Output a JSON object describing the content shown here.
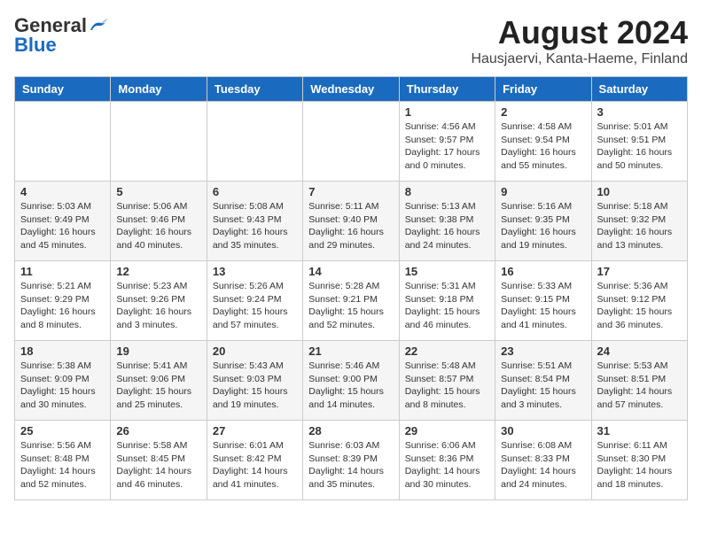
{
  "header": {
    "logo_general": "General",
    "logo_blue": "Blue",
    "month_year": "August 2024",
    "location": "Hausjaervi, Kanta-Haeme, Finland"
  },
  "days_of_week": [
    "Sunday",
    "Monday",
    "Tuesday",
    "Wednesday",
    "Thursday",
    "Friday",
    "Saturday"
  ],
  "weeks": [
    [
      {
        "day": "",
        "info": ""
      },
      {
        "day": "",
        "info": ""
      },
      {
        "day": "",
        "info": ""
      },
      {
        "day": "",
        "info": ""
      },
      {
        "day": "1",
        "info": "Sunrise: 4:56 AM\nSunset: 9:57 PM\nDaylight: 17 hours\nand 0 minutes."
      },
      {
        "day": "2",
        "info": "Sunrise: 4:58 AM\nSunset: 9:54 PM\nDaylight: 16 hours\nand 55 minutes."
      },
      {
        "day": "3",
        "info": "Sunrise: 5:01 AM\nSunset: 9:51 PM\nDaylight: 16 hours\nand 50 minutes."
      }
    ],
    [
      {
        "day": "4",
        "info": "Sunrise: 5:03 AM\nSunset: 9:49 PM\nDaylight: 16 hours\nand 45 minutes."
      },
      {
        "day": "5",
        "info": "Sunrise: 5:06 AM\nSunset: 9:46 PM\nDaylight: 16 hours\nand 40 minutes."
      },
      {
        "day": "6",
        "info": "Sunrise: 5:08 AM\nSunset: 9:43 PM\nDaylight: 16 hours\nand 35 minutes."
      },
      {
        "day": "7",
        "info": "Sunrise: 5:11 AM\nSunset: 9:40 PM\nDaylight: 16 hours\nand 29 minutes."
      },
      {
        "day": "8",
        "info": "Sunrise: 5:13 AM\nSunset: 9:38 PM\nDaylight: 16 hours\nand 24 minutes."
      },
      {
        "day": "9",
        "info": "Sunrise: 5:16 AM\nSunset: 9:35 PM\nDaylight: 16 hours\nand 19 minutes."
      },
      {
        "day": "10",
        "info": "Sunrise: 5:18 AM\nSunset: 9:32 PM\nDaylight: 16 hours\nand 13 minutes."
      }
    ],
    [
      {
        "day": "11",
        "info": "Sunrise: 5:21 AM\nSunset: 9:29 PM\nDaylight: 16 hours\nand 8 minutes."
      },
      {
        "day": "12",
        "info": "Sunrise: 5:23 AM\nSunset: 9:26 PM\nDaylight: 16 hours\nand 3 minutes."
      },
      {
        "day": "13",
        "info": "Sunrise: 5:26 AM\nSunset: 9:24 PM\nDaylight: 15 hours\nand 57 minutes."
      },
      {
        "day": "14",
        "info": "Sunrise: 5:28 AM\nSunset: 9:21 PM\nDaylight: 15 hours\nand 52 minutes."
      },
      {
        "day": "15",
        "info": "Sunrise: 5:31 AM\nSunset: 9:18 PM\nDaylight: 15 hours\nand 46 minutes."
      },
      {
        "day": "16",
        "info": "Sunrise: 5:33 AM\nSunset: 9:15 PM\nDaylight: 15 hours\nand 41 minutes."
      },
      {
        "day": "17",
        "info": "Sunrise: 5:36 AM\nSunset: 9:12 PM\nDaylight: 15 hours\nand 36 minutes."
      }
    ],
    [
      {
        "day": "18",
        "info": "Sunrise: 5:38 AM\nSunset: 9:09 PM\nDaylight: 15 hours\nand 30 minutes."
      },
      {
        "day": "19",
        "info": "Sunrise: 5:41 AM\nSunset: 9:06 PM\nDaylight: 15 hours\nand 25 minutes."
      },
      {
        "day": "20",
        "info": "Sunrise: 5:43 AM\nSunset: 9:03 PM\nDaylight: 15 hours\nand 19 minutes."
      },
      {
        "day": "21",
        "info": "Sunrise: 5:46 AM\nSunset: 9:00 PM\nDaylight: 15 hours\nand 14 minutes."
      },
      {
        "day": "22",
        "info": "Sunrise: 5:48 AM\nSunset: 8:57 PM\nDaylight: 15 hours\nand 8 minutes."
      },
      {
        "day": "23",
        "info": "Sunrise: 5:51 AM\nSunset: 8:54 PM\nDaylight: 15 hours\nand 3 minutes."
      },
      {
        "day": "24",
        "info": "Sunrise: 5:53 AM\nSunset: 8:51 PM\nDaylight: 14 hours\nand 57 minutes."
      }
    ],
    [
      {
        "day": "25",
        "info": "Sunrise: 5:56 AM\nSunset: 8:48 PM\nDaylight: 14 hours\nand 52 minutes."
      },
      {
        "day": "26",
        "info": "Sunrise: 5:58 AM\nSunset: 8:45 PM\nDaylight: 14 hours\nand 46 minutes."
      },
      {
        "day": "27",
        "info": "Sunrise: 6:01 AM\nSunset: 8:42 PM\nDaylight: 14 hours\nand 41 minutes."
      },
      {
        "day": "28",
        "info": "Sunrise: 6:03 AM\nSunset: 8:39 PM\nDaylight: 14 hours\nand 35 minutes."
      },
      {
        "day": "29",
        "info": "Sunrise: 6:06 AM\nSunset: 8:36 PM\nDaylight: 14 hours\nand 30 minutes."
      },
      {
        "day": "30",
        "info": "Sunrise: 6:08 AM\nSunset: 8:33 PM\nDaylight: 14 hours\nand 24 minutes."
      },
      {
        "day": "31",
        "info": "Sunrise: 6:11 AM\nSunset: 8:30 PM\nDaylight: 14 hours\nand 18 minutes."
      }
    ]
  ]
}
